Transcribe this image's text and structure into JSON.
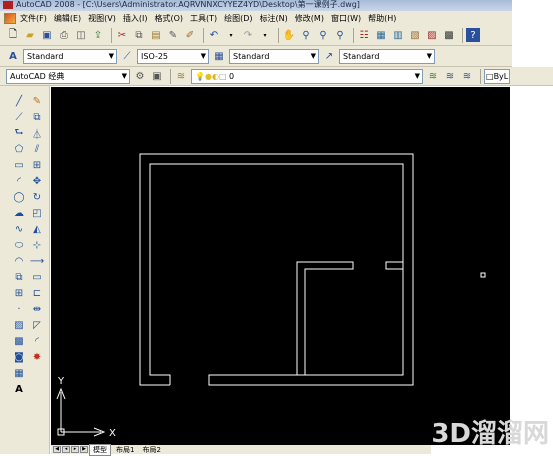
{
  "window": {
    "title": "AutoCAD 2008 - [C:\\Users\\Administrator.AQRVNNXCYYEZ4YD\\Desktop\\第一课例子.dwg]"
  },
  "menubar": {
    "items": [
      "文件(F)",
      "编辑(E)",
      "视图(V)",
      "插入(I)",
      "格式(O)",
      "工具(T)",
      "绘图(D)",
      "标注(N)",
      "修改(M)",
      "窗口(W)",
      "帮助(H)"
    ]
  },
  "styles_toolbar": {
    "text_style": "Standard",
    "dim_style": "ISO-25",
    "table_style": "Standard",
    "multileader_style": "Standard"
  },
  "layers_toolbar": {
    "workspace": "AutoCAD 经典",
    "current_layer": "0",
    "color_control": "ByL"
  },
  "canvas": {
    "ucs_x_label": "X",
    "ucs_y_label": "Y",
    "background": "#000000",
    "line_color": "#ffffff"
  },
  "tabs": {
    "items": [
      "模型",
      "布局1",
      "布局2"
    ],
    "active": "模型"
  },
  "watermark": {
    "text": "3D溜溜网"
  },
  "left_tools": {
    "col1": [
      "line-icon",
      "construction-line-icon",
      "polyline-icon",
      "polygon-icon",
      "rectangle-icon",
      "arc-icon",
      "circle-icon",
      "revision-cloud-icon",
      "spline-icon",
      "ellipse-icon",
      "ellipse-arc-icon",
      "insert-block-icon",
      "make-block-icon",
      "point-icon",
      "hatch-icon",
      "gradient-icon",
      "region-icon",
      "table-icon",
      "mtext-icon"
    ],
    "col2": [
      "erase-icon",
      "copy-icon",
      "mirror-icon",
      "offset-icon",
      "array-icon",
      "move-icon",
      "rotate-icon",
      "scale-icon",
      "stretch-icon",
      "trim-icon",
      "extend-icon",
      "break-point-icon",
      "break-icon",
      "join-icon",
      "chamfer-icon",
      "fillet-icon",
      "explode-icon"
    ],
    "text_tool_label": "A"
  }
}
